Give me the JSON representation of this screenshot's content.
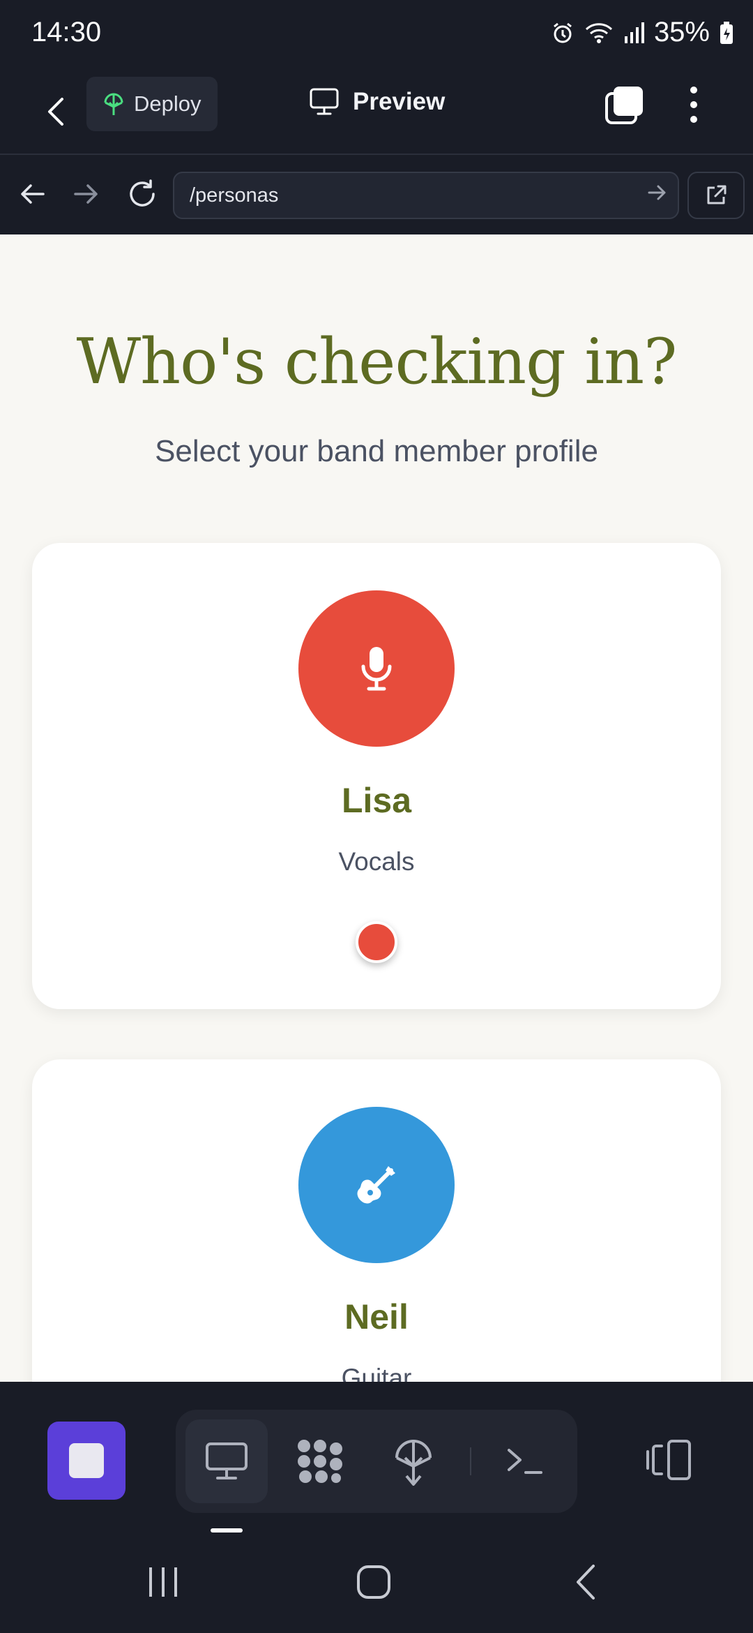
{
  "status_bar": {
    "time": "14:30",
    "battery": "35%",
    "icons": [
      "alarm-icon",
      "wifi-icon",
      "signal-icon",
      "battery-icon"
    ]
  },
  "app_header": {
    "deploy_label": "Deploy",
    "preview_label": "Preview",
    "icons": [
      "back-icon",
      "deploy-icon",
      "monitor-icon",
      "tabs-icon",
      "more-icon"
    ]
  },
  "browser": {
    "url": "/personas",
    "icons": [
      "back-arrow-icon",
      "forward-arrow-icon",
      "reload-icon",
      "go-arrow-icon",
      "external-link-icon"
    ]
  },
  "page": {
    "heading": "Who's checking in?",
    "subheading": "Select your band member profile",
    "members": [
      {
        "name": "Lisa",
        "role": "Vocals",
        "color": "#e74c3c",
        "icon": "microphone-icon"
      },
      {
        "name": "Neil",
        "role": "Guitar",
        "color": "#3498db",
        "icon": "guitar-icon"
      }
    ]
  },
  "toolbar": {
    "accent": "#5b3fd9",
    "items": [
      "stop-icon",
      "monitor-icon",
      "apps-grid-icon",
      "deploy-icon",
      "terminal-icon",
      "device-toggle-icon"
    ]
  },
  "colors": {
    "app_bg": "#191c26",
    "page_bg": "#f8f7f3",
    "heading": "#5d6b22",
    "text_muted": "#4b5263"
  }
}
